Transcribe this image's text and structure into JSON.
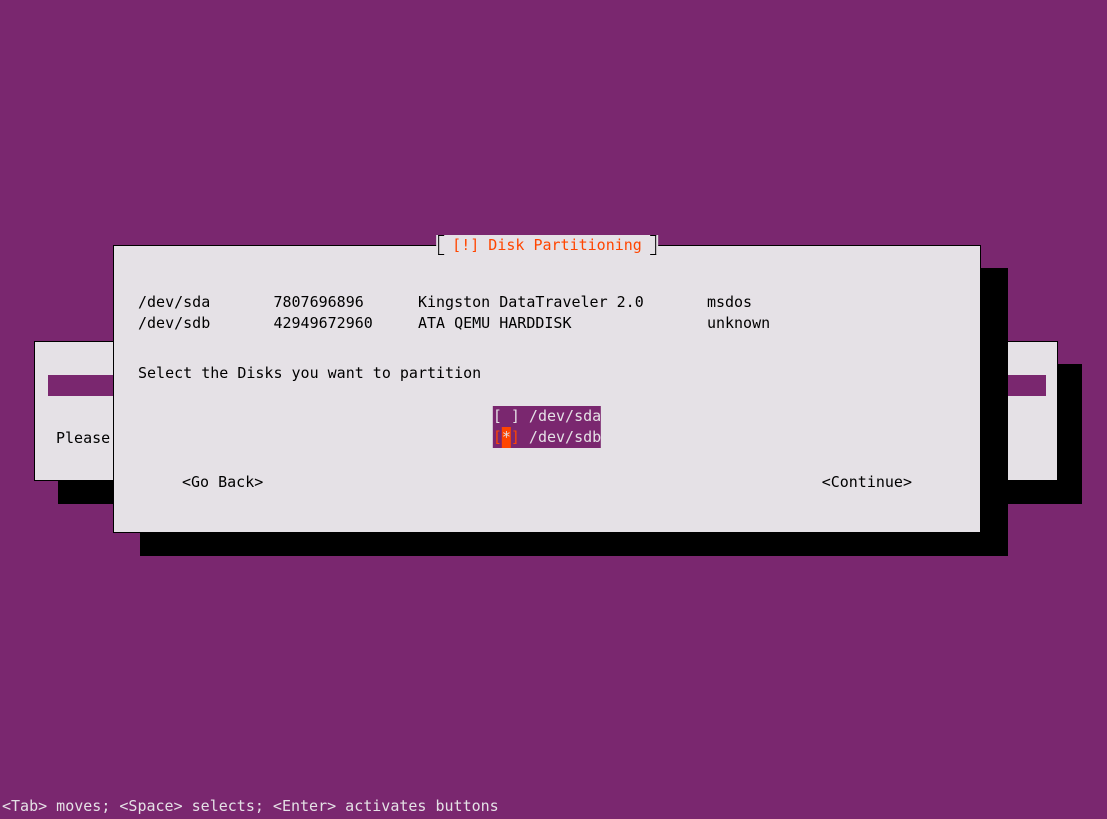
{
  "title": "[!] Disk Partitioning",
  "disks": [
    {
      "device": "/dev/sda",
      "size": "7807696896",
      "model": "Kingston DataTraveler 2.0",
      "table": "msdos"
    },
    {
      "device": "/dev/sdb",
      "size": "42949672960",
      "model": "ATA QEMU HARDDISK",
      "table": "unknown"
    }
  ],
  "instruction": "Select the Disks you want to partition",
  "options": [
    {
      "label": "/dev/sda",
      "checked": false,
      "active": false
    },
    {
      "label": "/dev/sdb",
      "checked": true,
      "active": true
    }
  ],
  "buttons": {
    "back": "<Go Back>",
    "continue": "<Continue>"
  },
  "bg_text": "Please",
  "footer": "<Tab> moves; <Space> selects; <Enter> activates buttons"
}
